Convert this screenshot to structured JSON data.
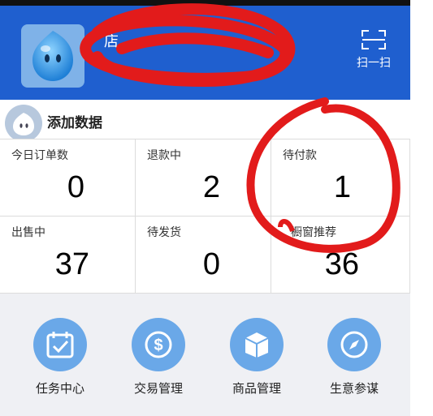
{
  "header": {
    "shop_name": "店",
    "shop_sub": "",
    "scan_label": "扫一扫"
  },
  "add_data": {
    "title": "添加数据"
  },
  "stats": [
    {
      "label": "今日订单数",
      "value": "0"
    },
    {
      "label": "退款中",
      "value": "2"
    },
    {
      "label": "待付款",
      "value": "1"
    },
    {
      "label": "出售中",
      "value": "37"
    },
    {
      "label": "待发货",
      "value": "0"
    },
    {
      "label": "橱窗推荐",
      "value": "36"
    }
  ],
  "nav": [
    {
      "label": "任务中心",
      "icon": "calendar-check-icon"
    },
    {
      "label": "交易管理",
      "icon": "dollar-icon"
    },
    {
      "label": "商品管理",
      "icon": "package-box-icon"
    },
    {
      "label": "生意参谋",
      "icon": "compass-icon"
    }
  ],
  "colors": {
    "header_bg": "#1f5fcf",
    "nav_circle": "#6aa8e8",
    "annotation_red": "#e21b1b",
    "nav_bg": "#eff0f4"
  }
}
